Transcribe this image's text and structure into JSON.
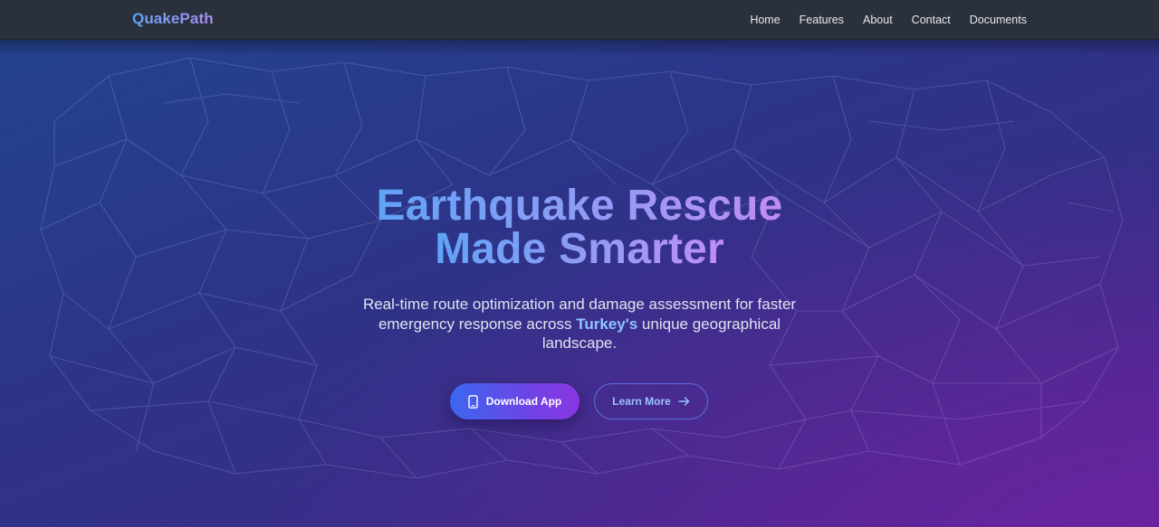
{
  "nav": {
    "brand": "QuakePath",
    "links": [
      {
        "label": "Home"
      },
      {
        "label": "Features"
      },
      {
        "label": "About"
      },
      {
        "label": "Contact"
      },
      {
        "label": "Documents"
      }
    ]
  },
  "hero": {
    "title_line1": "Earthquake Rescue",
    "title_line2": "Made Smarter",
    "subtitle_before": "Real-time route optimization and damage assessment for faster emergency response across ",
    "subtitle_highlight": "Turkey's",
    "subtitle_after": " unique geographical landscape.",
    "primary_button": {
      "label": "Download App",
      "icon": "smartphone-icon"
    },
    "secondary_button": {
      "label": "Learn More",
      "icon": "arrow-right-icon"
    },
    "background_map": "turkey-provinces-map"
  },
  "colors": {
    "nav_bg": "#2b313c",
    "hero_start": "#24438f",
    "hero_end": "#532392",
    "accent_blue": "#62a4f5",
    "accent_purple": "#c08cf5",
    "highlight": "#8fc4ff"
  }
}
